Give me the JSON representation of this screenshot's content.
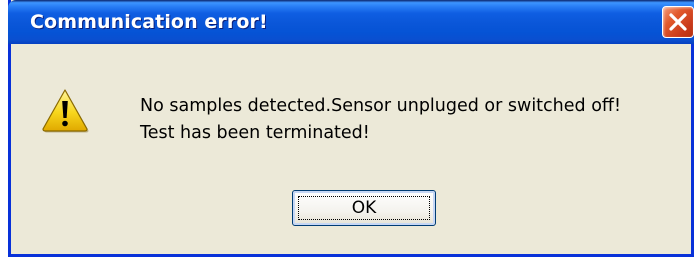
{
  "dialog": {
    "title": "Communication error!",
    "close_icon": "close-icon",
    "icon": "warning-icon",
    "message_lines": [
      "No samples detected.Sensor unpluged or switched off!",
      "Test has been terminated!"
    ],
    "ok_label": "OK"
  },
  "colors": {
    "titlebar": "#0a56d8",
    "window_border": "#0831d9",
    "body": "#ece9d8",
    "close_button": "#d9532c",
    "warning_yellow": "#f5d20a"
  }
}
